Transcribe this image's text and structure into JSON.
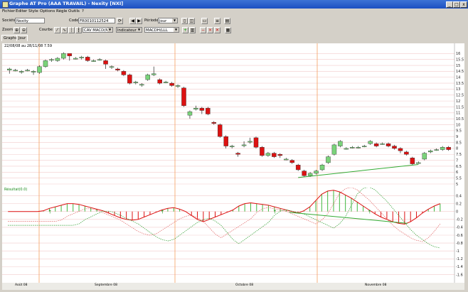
{
  "window": {
    "title": "Graphe AT Pro (AAA TRAVAIL) - Nexity  [NXI]",
    "minimize": "_",
    "maximize": "□",
    "close": "x"
  },
  "menu": [
    "Fichier",
    "Editer",
    "Style",
    "Options",
    "Règle",
    "Outils",
    "?"
  ],
  "toolbar1": {
    "societe_label": "Société",
    "societe_value": "Nexity",
    "code_label": "Code",
    "code_value": "FR0010112524",
    "periode_label": "Période",
    "periode_value": "Jour"
  },
  "toolbar2": {
    "zoom_label": "Zoom",
    "courbe_label": "Courbe",
    "courbe_value": "CAV MACD(MLL",
    "indicator_value": "Indicateur 1",
    "indicator_param": "MACDH(LLL"
  },
  "tabs": [
    "Graphe",
    "Jour"
  ],
  "chart_header": "22/08/08 au 28/11/08 7.59",
  "indicator_label": "Résultat(0.0)",
  "price_axis": [
    "16",
    "15.5",
    "15",
    "14.5",
    "14",
    "13.5",
    "13",
    "12.5",
    "12",
    "11.5",
    "11",
    "10.5",
    "10",
    "9.5",
    "9",
    "8.5",
    "8",
    "7.5",
    "7",
    "6.5",
    "6",
    "5.5",
    "5"
  ],
  "indicator_axis": [
    "0.4",
    "0.2",
    "0",
    "-0.2",
    "-0.4",
    "-0.6",
    "-0.8",
    "-1",
    "-1.2",
    "-1.4",
    "-1.6"
  ],
  "x_labels": [
    "Août 08",
    "Septembre 08",
    "Octobre 08",
    "Novembre 08"
  ],
  "colors": {
    "up": "#7ad37a",
    "down": "#dd1111",
    "orange": "#f5a060",
    "green_line": "#33aa33"
  },
  "chart_data": [
    {
      "type": "candlestick",
      "ylim": [
        5,
        16.5
      ],
      "candles": [
        [
          14.6,
          14.7,
          14.4,
          14.8,
          14.3
        ],
        [
          14.6,
          14.6,
          14.6,
          14.7,
          14.5
        ],
        [
          14.5,
          14.5,
          14.4,
          14.6,
          14.3
        ],
        [
          14.6,
          14.6,
          14.6,
          14.7,
          14.5
        ],
        [
          14.5,
          14.5,
          14.3,
          14.6,
          14.2
        ],
        [
          14.4,
          14.9,
          14.4,
          15,
          14.3
        ],
        [
          14.9,
          15.4,
          14.9,
          15.5,
          14.8
        ],
        [
          15.5,
          15.5,
          15.4,
          15.6,
          15.3
        ],
        [
          15.4,
          15.6,
          15.4,
          15.7,
          15.3
        ],
        [
          15.6,
          16,
          15.6,
          16.1,
          15.5
        ],
        [
          16,
          15.8,
          15.5,
          15.9,
          15.4
        ],
        [
          15.6,
          15.6,
          15.6,
          15.7,
          15.5
        ],
        [
          15.7,
          15.7,
          15.6,
          15.8,
          15.5
        ],
        [
          15.7,
          15.4,
          15.4,
          15.8,
          15.3
        ],
        [
          15.4,
          15.4,
          15.4,
          15.5,
          15.3
        ],
        [
          15.5,
          15.5,
          15.5,
          15.6,
          15.4
        ],
        [
          15.4,
          15.1,
          14.8,
          15.5,
          14.7
        ],
        [
          14.9,
          14.9,
          14.8,
          15,
          14.7
        ],
        [
          14.7,
          14.6,
          14.6,
          14.8,
          14.5
        ],
        [
          14.5,
          14.2,
          14.2,
          14.6,
          14.1
        ],
        [
          14.2,
          13.5,
          13.5,
          14.3,
          13.4
        ],
        [
          13.6,
          13.6,
          13.5,
          13.7,
          13.4
        ],
        [
          13.4,
          13.4,
          13.3,
          13.5,
          13.2
        ],
        [
          13.8,
          14.2,
          13.8,
          14.3,
          13.7
        ],
        [
          14.2,
          14.3,
          14.2,
          14.9,
          14.1
        ],
        [
          13.8,
          13.5,
          13.5,
          13.9,
          13.4
        ],
        [
          13.6,
          13.6,
          13.5,
          13.7,
          13.5
        ],
        [
          13.5,
          13.3,
          13.3,
          13.6,
          13.2
        ],
        [
          13.3,
          13.3,
          13.2,
          13.4,
          13.1
        ],
        [
          13.1,
          11.6,
          11.6,
          13.2,
          11.5
        ],
        [
          10.8,
          11.1,
          10.8,
          11.2,
          10.5
        ],
        [
          11.3,
          11.4,
          11.3,
          11.6,
          11.2
        ],
        [
          11.4,
          11.2,
          11,
          11.5,
          10.9
        ],
        [
          11.4,
          10.9,
          10.9,
          11.5,
          10.8
        ],
        [
          10.2,
          10.1,
          10.1,
          10.3,
          10
        ],
        [
          10,
          9,
          9,
          10.1,
          8.9
        ],
        [
          9,
          8.2,
          8.2,
          9.1,
          8
        ],
        [
          8.2,
          8.2,
          8.1,
          8.3,
          8
        ],
        [
          7.6,
          7.5,
          7.4,
          7.7,
          7.3
        ],
        [
          8.3,
          8.3,
          8.2,
          8.6,
          8.1
        ],
        [
          8.6,
          8.6,
          8.5,
          8.9,
          8.4
        ],
        [
          8.9,
          8.1,
          8.1,
          9,
          8
        ],
        [
          8.1,
          7.4,
          7.4,
          8.2,
          7.3
        ],
        [
          7.4,
          7.6,
          7.4,
          7.7,
          7.3
        ],
        [
          7.6,
          7.3,
          7.3,
          7.7,
          7.2
        ],
        [
          7.5,
          7.4,
          7.3,
          7.6,
          7.2
        ],
        [
          7.1,
          7.1,
          7.1,
          7.2,
          7
        ],
        [
          7,
          6.8,
          6.8,
          7.1,
          6.7
        ],
        [
          6.6,
          6.2,
          6.2,
          6.7,
          6.1
        ],
        [
          6.1,
          5.7,
          5.7,
          6.2,
          5.6
        ],
        [
          5.7,
          5.9,
          5.7,
          6,
          5.6
        ],
        [
          5.9,
          6.1,
          5.9,
          6.2,
          5.8
        ],
        [
          6.2,
          6.6,
          6.2,
          6.7,
          6.1
        ],
        [
          6.8,
          7.3,
          6.8,
          7.4,
          6.7
        ],
        [
          7.5,
          8.3,
          7.5,
          8.4,
          7.4
        ],
        [
          8.2,
          8.6,
          8.2,
          8.7,
          8.1
        ],
        [
          8,
          8,
          7.9,
          8.1,
          7.9
        ],
        [
          8.1,
          8.1,
          8,
          8.2,
          8
        ],
        [
          8.1,
          8.1,
          8,
          8.2,
          8
        ],
        [
          8.2,
          8.2,
          8.1,
          8.3,
          8.1
        ],
        [
          8.4,
          8.6,
          8.4,
          8.7,
          8.3
        ],
        [
          8.4,
          8.2,
          8.2,
          8.5,
          8.1
        ],
        [
          8.4,
          8.4,
          8.3,
          8.5,
          8.3
        ],
        [
          8.4,
          8.2,
          8.2,
          8.5,
          8.1
        ],
        [
          8.2,
          8,
          8,
          8.3,
          7.9
        ],
        [
          8,
          7.8,
          7.7,
          8.1,
          7.6
        ],
        [
          7.7,
          7.5,
          7.5,
          7.8,
          7.4
        ],
        [
          7.2,
          6.7,
          6.7,
          7.3,
          6.6
        ],
        [
          6.8,
          6.8,
          6.8,
          6.9,
          6.7
        ],
        [
          7.1,
          7.6,
          7.1,
          7.7,
          7
        ],
        [
          7.7,
          7.8,
          7.7,
          7.9,
          7.6
        ],
        [
          7.9,
          7.9,
          7.8,
          8,
          7.8
        ],
        [
          7.9,
          8.1,
          7.9,
          8.2,
          7.8
        ],
        [
          8.1,
          7.9,
          7.9,
          8.2,
          7.8
        ]
      ],
      "annotations": [
        "support-line"
      ]
    },
    {
      "type": "histogram+lines",
      "ylim": [
        -1.7,
        0.5
      ],
      "histogram": [
        0,
        0,
        0,
        0,
        0,
        0,
        0.02,
        0.08,
        0.12,
        0.16,
        0.2,
        0.2,
        0.18,
        0.14,
        0.1,
        0.06,
        0.02,
        -0.04,
        -0.1,
        -0.16,
        -0.2,
        -0.22,
        -0.2,
        -0.14,
        -0.08,
        -0.02,
        0.04,
        0.08,
        0.1,
        0.06,
        0.0,
        -0.1,
        -0.2,
        -0.26,
        -0.2,
        -0.14,
        -0.08,
        -0.02,
        0.04,
        0.14,
        0.2,
        0.22,
        0.2,
        0.18,
        0.16,
        0.12,
        0.08,
        0.04,
        0.0,
        -0.04,
        0.02,
        0.12,
        0.28,
        0.44,
        0.52,
        0.54,
        0.5,
        0.42,
        0.34,
        0.24,
        0.14,
        0.04,
        -0.06,
        -0.14,
        -0.2,
        -0.26,
        -0.3,
        -0.32,
        -0.26,
        -0.16,
        -0.04,
        0.06,
        0.14,
        0.2
      ]
    }
  ]
}
